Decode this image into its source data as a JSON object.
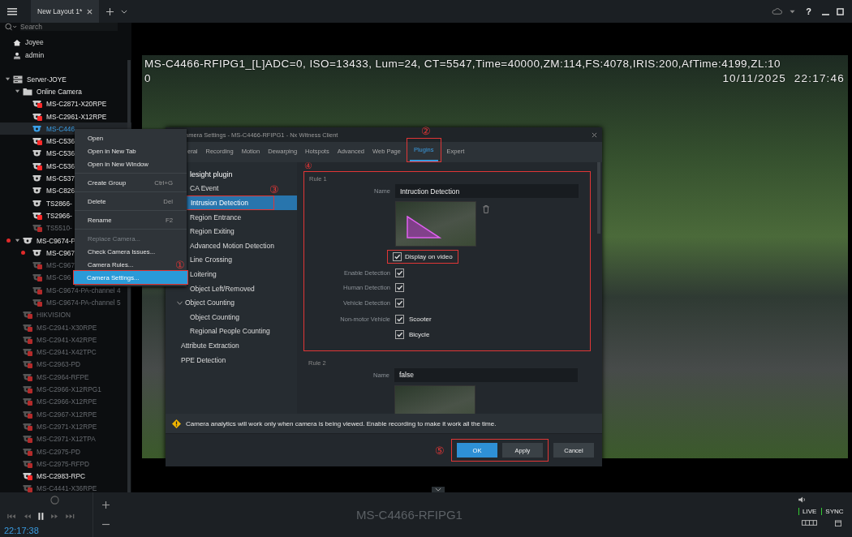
{
  "top_bar": {
    "layout_tabs": [
      {
        "label": "New Layout 1*",
        "selected": true
      }
    ],
    "help_label": "?"
  },
  "sidebar": {
    "search": {
      "placeholder": "Search"
    },
    "accounts": [
      {
        "label": "Joyee",
        "kind": "home"
      },
      {
        "label": "admin",
        "kind": "user"
      }
    ],
    "tree": [
      {
        "label": "Server-JOYE",
        "kind": "server",
        "expanded": true,
        "selected": false,
        "disabled": false,
        "children": [
          {
            "label": "Online Camera",
            "kind": "folder",
            "expanded": true,
            "selected": false,
            "disabled": false,
            "children": [
              {
                "label": "MS-C2871-X20RPE",
                "kind": "camera",
                "selected": false,
                "disabled": false,
                "locked": true,
                "alert": false
              },
              {
                "label": "MS-C2961-X12RPE",
                "kind": "camera",
                "selected": false,
                "disabled": false,
                "locked": true,
                "alert": false
              },
              {
                "label": "MS-C446",
                "kind": "camera",
                "selected": true,
                "disabled": false,
                "locked": false,
                "alert": false
              },
              {
                "label": "MS-C536",
                "kind": "camera",
                "selected": false,
                "disabled": false,
                "locked": true,
                "alert": false
              },
              {
                "label": "MS-C536",
                "kind": "camera",
                "selected": false,
                "disabled": false,
                "locked": false,
                "alert": false
              },
              {
                "label": "MS-C536",
                "kind": "camera",
                "selected": false,
                "disabled": false,
                "locked": true,
                "alert": false
              },
              {
                "label": "MS-C537",
                "kind": "camera",
                "selected": false,
                "disabled": false,
                "locked": false,
                "alert": false
              },
              {
                "label": "MS-C826",
                "kind": "camera",
                "selected": false,
                "disabled": false,
                "locked": false,
                "alert": false
              },
              {
                "label": "TS2866-",
                "kind": "camera",
                "selected": false,
                "disabled": false,
                "locked": false,
                "alert": false
              },
              {
                "label": "TS2966-",
                "kind": "camera",
                "selected": false,
                "disabled": false,
                "locked": true,
                "alert": false
              },
              {
                "label": "TS5510-",
                "kind": "camera",
                "selected": false,
                "disabled": true,
                "locked": true,
                "alert": false
              }
            ]
          },
          {
            "label": "MS-C9674-P",
            "kind": "group",
            "expanded": true,
            "selected": false,
            "disabled": false,
            "alert": true,
            "children": [
              {
                "label": "MS-C967",
                "kind": "camera",
                "selected": false,
                "disabled": false,
                "locked": false,
                "alert": true
              },
              {
                "label": "MS-C967",
                "kind": "camera",
                "selected": false,
                "disabled": true,
                "locked": true,
                "alert": false
              },
              {
                "label": "MS-C96",
                "kind": "camera",
                "selected": false,
                "disabled": true,
                "locked": true,
                "alert": false
              },
              {
                "label": "MS-C9674-PA-channel 4",
                "kind": "camera",
                "selected": false,
                "disabled": true,
                "locked": true,
                "alert": false
              },
              {
                "label": "MS-C9674-PA-channel 5",
                "kind": "camera",
                "selected": false,
                "disabled": true,
                "locked": true,
                "alert": false
              }
            ]
          },
          {
            "label": "HIKVISION",
            "kind": "camera",
            "selected": false,
            "disabled": true,
            "locked": true,
            "alert": false
          },
          {
            "label": "MS-C2941-X30RPE",
            "kind": "camera",
            "selected": false,
            "disabled": true,
            "locked": true,
            "alert": false
          },
          {
            "label": "MS-C2941-X42RPE",
            "kind": "camera",
            "selected": false,
            "disabled": true,
            "locked": true,
            "alert": false
          },
          {
            "label": "MS-C2941-X42TPC",
            "kind": "camera",
            "selected": false,
            "disabled": true,
            "locked": true,
            "alert": false
          },
          {
            "label": "MS-C2963-PD",
            "kind": "camera",
            "selected": false,
            "disabled": true,
            "locked": true,
            "alert": false
          },
          {
            "label": "MS-C2964-RFPE",
            "kind": "camera",
            "selected": false,
            "disabled": true,
            "locked": true,
            "alert": false
          },
          {
            "label": "MS-C2966-X12RPG1",
            "kind": "camera",
            "selected": false,
            "disabled": true,
            "locked": true,
            "alert": false
          },
          {
            "label": "MS-C2966-X12RPE",
            "kind": "camera",
            "selected": false,
            "disabled": true,
            "locked": true,
            "alert": false
          },
          {
            "label": "MS-C2967-X12RPE",
            "kind": "camera",
            "selected": false,
            "disabled": true,
            "locked": true,
            "alert": false
          },
          {
            "label": "MS-C2971-X12RPE",
            "kind": "camera",
            "selected": false,
            "disabled": true,
            "locked": true,
            "alert": false
          },
          {
            "label": "MS-C2971-X12TPA",
            "kind": "camera",
            "selected": false,
            "disabled": true,
            "locked": true,
            "alert": false
          },
          {
            "label": "MS-C2975-PD",
            "kind": "camera",
            "selected": false,
            "disabled": true,
            "locked": true,
            "alert": false
          },
          {
            "label": "MS-C2975-RFPD",
            "kind": "camera",
            "selected": false,
            "disabled": true,
            "locked": true,
            "alert": false
          },
          {
            "label": "MS-C2983-RPC",
            "kind": "camera",
            "selected": false,
            "disabled": false,
            "locked": true,
            "alert": false
          },
          {
            "label": "MS-C4441-X36RPE",
            "kind": "camera",
            "selected": false,
            "disabled": true,
            "locked": true,
            "alert": false
          }
        ]
      }
    ]
  },
  "context_menu": {
    "marker": "①",
    "items": [
      {
        "kind": "item",
        "label": "Open",
        "disabled": false,
        "selected": false,
        "highlighted": false
      },
      {
        "kind": "item",
        "label": "Open in New Tab",
        "disabled": false,
        "selected": false,
        "highlighted": false
      },
      {
        "kind": "item",
        "label": "Open in New Window",
        "disabled": false,
        "selected": false,
        "highlighted": false
      },
      {
        "kind": "separator"
      },
      {
        "kind": "item",
        "label": "Create Group",
        "shortcut": "Ctrl+G",
        "disabled": false,
        "selected": false,
        "highlighted": false
      },
      {
        "kind": "separator"
      },
      {
        "kind": "item",
        "label": "Delete",
        "shortcut": "Del",
        "disabled": false,
        "selected": false,
        "highlighted": false
      },
      {
        "kind": "separator"
      },
      {
        "kind": "item",
        "label": "Rename",
        "shortcut": "F2",
        "disabled": false,
        "selected": false,
        "highlighted": false
      },
      {
        "kind": "separator"
      },
      {
        "kind": "item",
        "label": "Replace Camera...",
        "disabled": true,
        "selected": false,
        "highlighted": false
      },
      {
        "kind": "item",
        "label": "Check Camera Issues...",
        "disabled": false,
        "selected": false,
        "highlighted": false
      },
      {
        "kind": "item",
        "label": "Camera Rules...",
        "disabled": false,
        "selected": false,
        "highlighted": false
      },
      {
        "kind": "item",
        "label": "Camera Settings...",
        "disabled": false,
        "selected": true,
        "highlighted": true
      }
    ]
  },
  "video": {
    "osd_line": "MS-C4466-RFIPG1_[L]ADC=0, ISO=13433, Lum=24, CT=5547,Time=40000,ZM:114,FS:4078,IRIS:200,AfTime:4199,ZL:10",
    "osd_line_2": "0",
    "osd_timestamp": "10/11/2025  22:17:46"
  },
  "dialog": {
    "title": "amera Settings - MS-C4466-RFIPG1 - Nx Witness Client",
    "tab_marker": "②",
    "tabs": [
      {
        "label": "eral",
        "selected": false,
        "highlighted": false
      },
      {
        "label": "Recording",
        "selected": false,
        "highlighted": false
      },
      {
        "label": "Motion",
        "selected": false,
        "highlighted": false
      },
      {
        "label": "Dewarping",
        "selected": false,
        "highlighted": false
      },
      {
        "label": "Hotspots",
        "selected": false,
        "highlighted": false
      },
      {
        "label": "Advanced",
        "selected": false,
        "highlighted": false
      },
      {
        "label": "Web Page",
        "selected": false,
        "highlighted": false
      },
      {
        "label": "Plugins",
        "selected": true,
        "highlighted": true
      },
      {
        "label": "Expert",
        "selected": false,
        "highlighted": false
      }
    ],
    "plugin_marker": "③",
    "plugins": [
      {
        "kind": "header",
        "label": "lesight plugin"
      },
      {
        "kind": "item",
        "label": "CA Event",
        "selected": false,
        "highlighted": false
      },
      {
        "kind": "item",
        "label": "Intrusion Detection",
        "selected": true,
        "highlighted": true
      },
      {
        "kind": "item",
        "label": "Region Entrance",
        "selected": false,
        "highlighted": false
      },
      {
        "kind": "item",
        "label": "Region Exiting",
        "selected": false,
        "highlighted": false
      },
      {
        "kind": "item",
        "label": "Advanced Motion Detection",
        "selected": false,
        "highlighted": false
      },
      {
        "kind": "item",
        "label": "Line Crossing",
        "selected": false,
        "highlighted": false
      },
      {
        "kind": "item",
        "label": "Loitering",
        "selected": false,
        "highlighted": false
      },
      {
        "kind": "item",
        "label": "Object Left/Removed",
        "selected": false,
        "highlighted": false
      },
      {
        "kind": "group",
        "label": "Object Counting",
        "expanded": true,
        "children": [
          {
            "label": "Object Counting",
            "selected": false
          },
          {
            "label": "Regional People Counting",
            "selected": false
          }
        ]
      },
      {
        "kind": "top",
        "label": "Attribute Extraction",
        "selected": false,
        "highlighted": false
      },
      {
        "kind": "top",
        "label": "PPE Detection",
        "selected": false,
        "highlighted": false
      }
    ],
    "rules": [
      {
        "title": "Rule 1",
        "highlighted": true,
        "marker": "④",
        "name_label": "Name",
        "name_value": "Intruction Detection",
        "display_on_video": {
          "label": "Display on video",
          "checked": true,
          "highlighted": true
        },
        "options": [
          {
            "label": "Enable Detection",
            "checked": true
          },
          {
            "label": "Human Detection",
            "checked": true
          },
          {
            "label": "Vehicle Detection",
            "checked": true
          }
        ],
        "non_motor": {
          "label": "Non-motor Vehicle",
          "options": [
            {
              "label": "Scooter",
              "checked": true
            },
            {
              "label": "Bicycle",
              "checked": true
            }
          ]
        }
      },
      {
        "title": "Rule 2",
        "highlighted": false,
        "name_label": "Name",
        "name_value": "false"
      }
    ],
    "warning": "Camera analytics will work only when camera is being viewed. Enable recording to make it work all the time.",
    "footer_marker": "⑤",
    "framed_buttons": [
      {
        "label": "OK",
        "kind": "primary"
      },
      {
        "label": "Apply",
        "kind": "normal"
      }
    ],
    "buttons": [
      {
        "label": "Cancel",
        "kind": "normal"
      }
    ]
  },
  "player": {
    "time": "22:17:38",
    "camera_name": "MS-C4466-RFIPG1",
    "live_label": "LIVE",
    "sync_label": "SYNC"
  }
}
